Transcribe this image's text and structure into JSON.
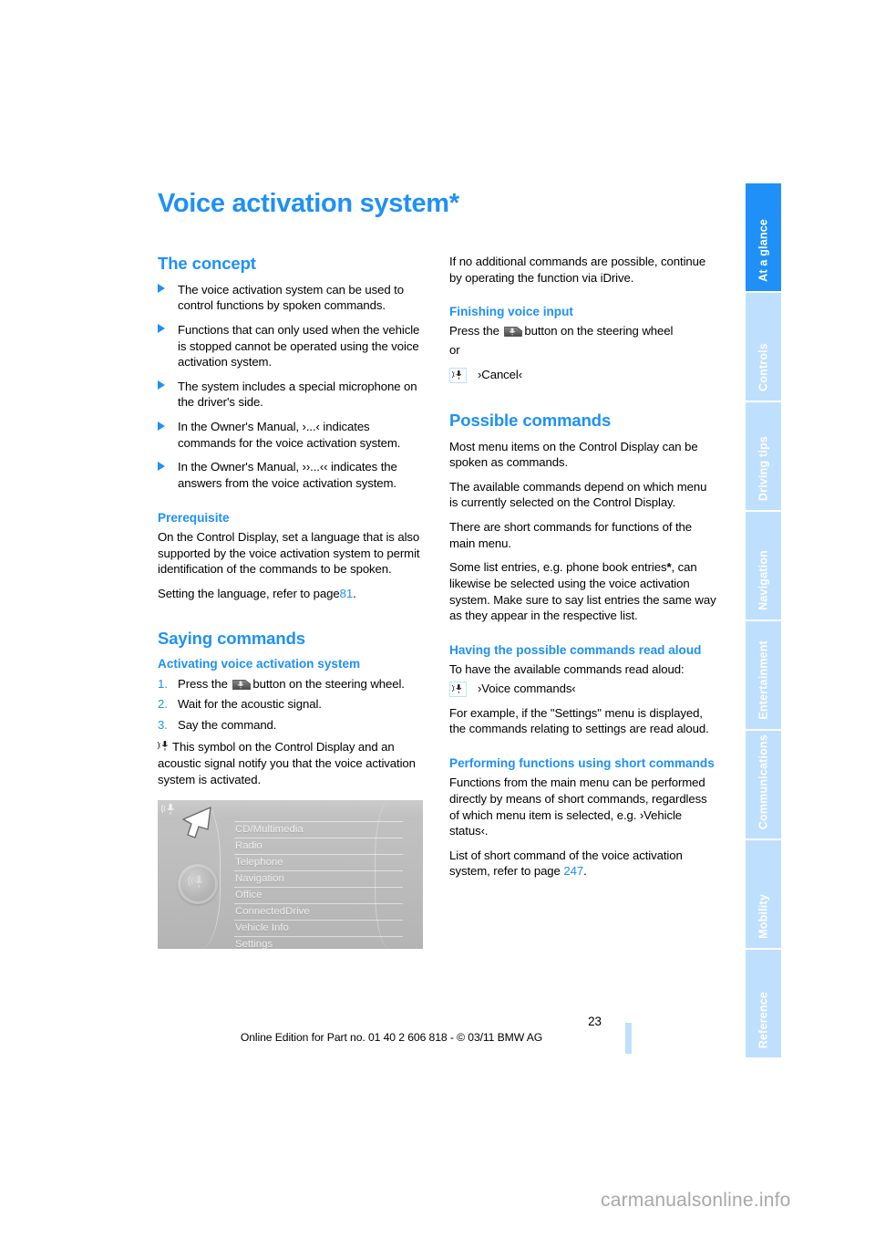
{
  "sidebar": {
    "tabs": [
      {
        "label": "At a glance",
        "active": true
      },
      {
        "label": "Controls",
        "active": false
      },
      {
        "label": "Driving tips",
        "active": false
      },
      {
        "label": "Navigation",
        "active": false
      },
      {
        "label": "Entertainment",
        "active": false
      },
      {
        "label": "Communications",
        "active": false
      },
      {
        "label": "Mobility",
        "active": false
      },
      {
        "label": "Reference",
        "active": false
      }
    ]
  },
  "page": {
    "title": "Voice activation system",
    "title_star": "*",
    "number": "23",
    "footer": "Online Edition for Part no. 01 40 2 606 818 - © 03/11 BMW AG",
    "watermark": "carmanualsonline.info"
  },
  "left_column": {
    "concept": {
      "heading": "The concept",
      "bullets": [
        "The voice activation system can be used to control functions by spoken commands.",
        "Functions that can only used when the vehicle is stopped cannot be operated using the voice activation system.",
        "The system includes a special microphone on the driver's side.",
        "In the Owner's Manual, ›...‹ indicates commands for the voice activation system.",
        "In the Owner's Manual, ››...‹‹ indicates the answers from the voice activation system."
      ]
    },
    "prerequisite": {
      "heading": "Prerequisite",
      "paragraph1": "On the Control Display, set a language that is also supported by the voice activation system to permit identification of the commands to be spoken.",
      "paragraph2_pre": "Setting the language, refer to page",
      "paragraph2_page": "81",
      "paragraph2_post": "."
    },
    "saying_commands": {
      "heading": "Saying commands",
      "subheading": "Activating voice activation system",
      "steps": [
        {
          "num": "1.",
          "pre": "Press the",
          "post": "button on the steering wheel.",
          "has_button_icon": true
        },
        {
          "num": "2.",
          "pre": "Wait for the acoustic signal.",
          "post": "",
          "has_button_icon": false
        },
        {
          "num": "3.",
          "pre": "Say the command.",
          "post": "",
          "has_button_icon": false
        }
      ],
      "note": "This symbol on the Control Display and an acoustic signal notify you that the voice activation system is activated."
    },
    "figure": {
      "name": "control-display-main-menu",
      "items": [
        "CD/Multimedia",
        "Radio",
        "Telephone",
        "Navigation",
        "Office",
        "ConnectedDrive",
        "Vehicle Info",
        "Settings"
      ]
    }
  },
  "right_column": {
    "intro": "If no additional commands are possible, continue by operating the function via iDrive.",
    "finishing": {
      "heading": "Finishing voice input",
      "line1_pre": "Press the",
      "line1_post": "button on the steering wheel",
      "or": "or",
      "command": "›Cancel‹"
    },
    "possible_commands": {
      "heading": "Possible commands",
      "paragraphs": [
        "Most menu items on the Control Display can be spoken as commands.",
        "The available commands depend on which menu is currently selected on the Control Display.",
        "There are short commands for functions of the main menu."
      ],
      "list_entries_pre": "Some list entries, e.g. phone book entries",
      "list_entries_star": "*",
      "list_entries_post": ", can likewise be selected using the voice activation system. Make sure to say list entries the same way as they appear in the respective list."
    },
    "read_aloud": {
      "heading": "Having the possible commands read aloud",
      "intro": "To have the available commands read aloud:",
      "command": "›Voice commands‹",
      "example": "For example, if the \"Settings\" menu is displayed, the commands relating to settings are read aloud."
    },
    "short_commands": {
      "heading": "Performing functions using short commands",
      "paragraph_pre": "Functions from the main menu can be performed directly by means of short commands, regardless of which menu item is selected, e.g.",
      "paragraph_command": "›Vehicle status‹",
      "paragraph_post": ".",
      "refer_pre": "List of short command of the voice activation system, refer to page",
      "refer_page": "247",
      "refer_post": "."
    }
  },
  "colors": {
    "accent_blue": "#1e90f7",
    "tab_inactive": "#bfdfff",
    "text": "#000000"
  }
}
